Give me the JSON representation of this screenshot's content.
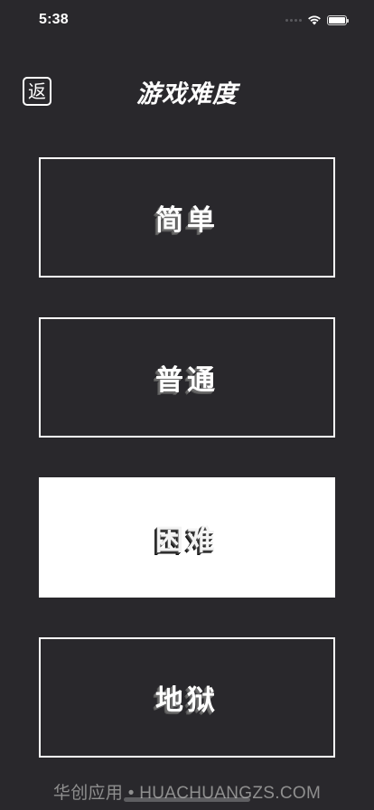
{
  "status_bar": {
    "time": "5:38",
    "icons": [
      "signal-icon",
      "wifi-icon",
      "battery-icon"
    ]
  },
  "header": {
    "back_label": "返",
    "title": "游戏难度"
  },
  "levels": [
    {
      "label": "简单",
      "selected": false
    },
    {
      "label": "普通",
      "selected": false
    },
    {
      "label": "困难",
      "selected": true
    },
    {
      "label": "地狱",
      "selected": false
    }
  ],
  "footer": {
    "watermark": "华创应用 • HUACHUANGZS.COM"
  },
  "colors": {
    "background": "#29282c",
    "foreground": "#ffffff",
    "selected_card": "#ffffff"
  }
}
